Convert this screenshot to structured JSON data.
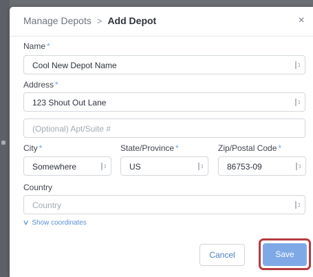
{
  "header": {
    "parent": "Manage Depots",
    "separator": ">",
    "current": "Add Depot",
    "close": "×"
  },
  "form": {
    "name_label": "Name",
    "name_value": "Cool New Depot Name",
    "address_label": "Address",
    "address_value": "123 Shout Out Lane",
    "apt_placeholder": "(Optional) Apt/Suite #",
    "city_label": "City",
    "city_value": "Somewhere",
    "state_label": "State/Province",
    "state_value": "US",
    "zip_label": "Zip/Postal Code",
    "zip_value": "86753-09",
    "country_label": "Country",
    "country_placeholder": "Country",
    "required_mark": "*"
  },
  "show_coordinates": "Show coordinates",
  "buttons": {
    "cancel": "Cancel",
    "save": "Save"
  },
  "colors": {
    "accent": "#7fa9e6",
    "required": "#6aa8ea",
    "highlight": "#b53a3f"
  }
}
